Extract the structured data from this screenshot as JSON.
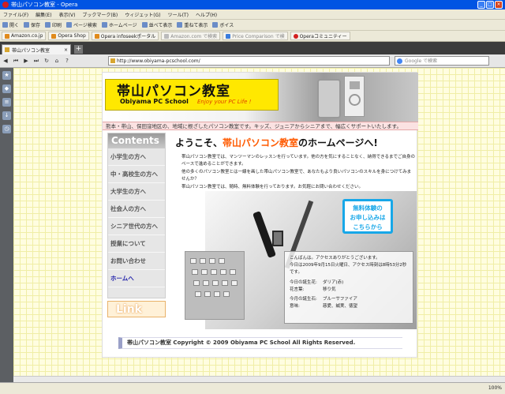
{
  "window": {
    "title": "帯山パソコン教室 - Opera"
  },
  "menu": [
    "ファイル(F)",
    "編集(E)",
    "表示(V)",
    "ブックマーク(B)",
    "ウィジェット(G)",
    "ツール(T)",
    "ヘルプ(H)"
  ],
  "toolbar": [
    "開く",
    "保存",
    "印刷",
    "ページ検索",
    "ホームページ",
    "並べて表示",
    "重ねて表示",
    "ボイス"
  ],
  "bookmarks": [
    {
      "label": "Amazon.co.jp",
      "dim": false
    },
    {
      "label": "Opera Shop",
      "dim": false
    },
    {
      "label": "Opera infoseekポータル",
      "dim": false
    },
    {
      "label": "Amazon.com で検索",
      "dim": true
    },
    {
      "label": "Price Comparison で検",
      "dim": true
    },
    {
      "label": "Operaコミュニティー",
      "dim": false
    }
  ],
  "tab": {
    "label": "帯山パソコン教室",
    "close": "×",
    "new": "+"
  },
  "address": {
    "url": "http://www.obiyama-pcschool.com/",
    "search_placeholder": "Google で検索"
  },
  "site": {
    "logo_jp": "帯山パソコン教室",
    "logo_en": "Obiyama PC School",
    "logo_tag": "Enjoy your PC Life !",
    "tagline": "熊本・帯山、保田窪地区の、地域に根ざしたパソコン教室です。キッズ、ジュニアからシニアまで、幅広くサポートいたします。",
    "contents": "Contents",
    "nav": [
      "小学生の方へ",
      "中・高校生の方へ",
      "大学生の方へ",
      "社会人の方へ",
      "シニア世代の方へ",
      "授業について",
      "お問い合わせ",
      "ホームへ"
    ],
    "link_label": "Link",
    "welcome_pre": "ようこそ、",
    "welcome_em": "帯山パソコン教室",
    "welcome_post": "のホームページへ!",
    "intro": [
      "帯山パソコン教室では、マンツーマンのレッスンを行っています。他の方を気にすることなく、納得できるまでご自身のペースで進めることができます。",
      "他の多くのパソコン教室とは一線を画した帯山パソコン教室で、あなたもより良いパソコンのスキルを身につけてみませんか？",
      "帯山パソコン教室では、随時、無料体験を行っております。お気軽にお問い合わせください。"
    ],
    "trial_button": [
      "無料体験の",
      "お申し込みは",
      "こちらから"
    ],
    "info": {
      "greeting": "こんばんは。アクセスありがとうございます。",
      "date": "今日は2009年9月15日火曜日、アクセス時刻は8時53分2秒です。",
      "rows": [
        {
          "k": "今日の誕生花:",
          "v": "ダリア(赤)"
        },
        {
          "k": "花言葉:",
          "v": "移り気"
        },
        {
          "k": "今月の誕生石:",
          "v": "ブルーサファイア"
        },
        {
          "k": "意味:",
          "v": "慈愛、誠実、徳望"
        }
      ]
    },
    "footer": "帯山パソコン教室 Copyright © 2009 Obiyama PC School All Rights Reserved."
  },
  "status": {
    "zoom": "100%"
  }
}
